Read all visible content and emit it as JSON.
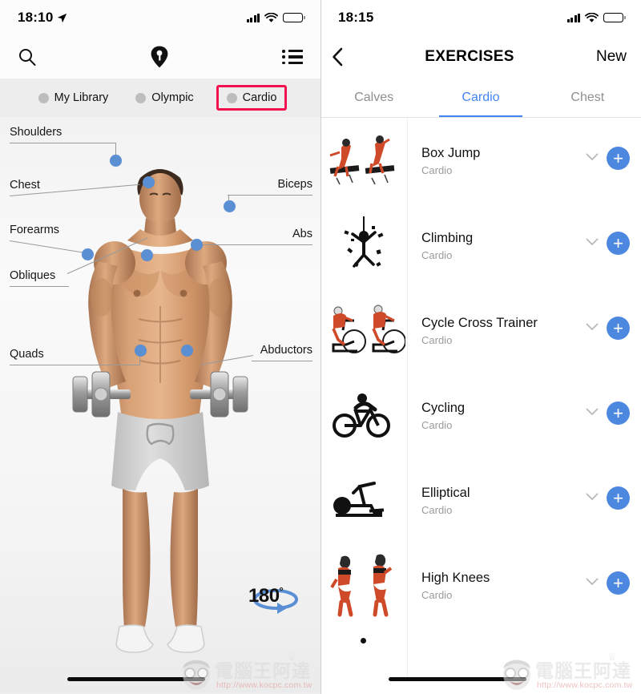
{
  "left_phone": {
    "status": {
      "time": "18:10",
      "location_icon": "location-arrow-icon",
      "signal_icon": "cellular-bars-icon",
      "wifi_icon": "wifi-icon",
      "battery_icon": "battery-icon"
    },
    "navbar": {
      "search_icon": "search-icon",
      "logo_icon": "pin-logo-icon",
      "menu_icon": "list-menu-icon"
    },
    "segments": [
      {
        "label": "My Library",
        "selected": false,
        "highlighted": false
      },
      {
        "label": "Olympic",
        "selected": false,
        "highlighted": false
      },
      {
        "label": "Cardio",
        "selected": true,
        "highlighted": true
      }
    ],
    "highlight_color": "#f3104e",
    "muscle_labels": [
      {
        "label": "Shoulders"
      },
      {
        "label": "Chest"
      },
      {
        "label": "Forearms"
      },
      {
        "label": "Obliques"
      },
      {
        "label": "Quads"
      },
      {
        "label": "Biceps"
      },
      {
        "label": "Abs"
      },
      {
        "label": "Abductors"
      }
    ],
    "rotate": {
      "value": "180",
      "degree": "°",
      "icon": "rotate-arrow-icon"
    },
    "dot_color": "#5b8fd4",
    "watermark": {
      "text": "電腦王阿達",
      "url": "http://www.kocpc.com.tw"
    }
  },
  "right_phone": {
    "status": {
      "time": "18:15",
      "signal_icon": "cellular-bars-icon",
      "wifi_icon": "wifi-icon",
      "battery_icon": "battery-icon"
    },
    "navbar": {
      "back_icon": "chevron-left-icon",
      "title": "EXERCISES",
      "action": "New"
    },
    "tabs": [
      {
        "label": "Calves",
        "active": false
      },
      {
        "label": "Cardio",
        "active": true
      },
      {
        "label": "Chest",
        "active": false
      }
    ],
    "accent_color": "#4285f4",
    "add_button_color": "#4d88e0",
    "exercises": [
      {
        "name": "Box Jump",
        "category": "Cardio",
        "thumb": "box-jump-illustration",
        "expand_icon": "chevron-down-icon",
        "add_icon": "plus-icon"
      },
      {
        "name": "Climbing",
        "category": "Cardio",
        "thumb": "climbing-illustration",
        "expand_icon": "chevron-down-icon",
        "add_icon": "plus-icon"
      },
      {
        "name": "Cycle Cross Trainer",
        "category": "Cardio",
        "thumb": "cycle-cross-trainer-illustration",
        "expand_icon": "chevron-down-icon",
        "add_icon": "plus-icon"
      },
      {
        "name": "Cycling",
        "category": "Cardio",
        "thumb": "cycling-illustration",
        "expand_icon": "chevron-down-icon",
        "add_icon": "plus-icon"
      },
      {
        "name": "Elliptical",
        "category": "Cardio",
        "thumb": "elliptical-illustration",
        "expand_icon": "chevron-down-icon",
        "add_icon": "plus-icon"
      },
      {
        "name": "High Knees",
        "category": "Cardio",
        "thumb": "high-knees-illustration",
        "expand_icon": "chevron-down-icon",
        "add_icon": "plus-icon"
      }
    ],
    "watermark": {
      "text": "電腦王阿達",
      "url": "http://www.kocpc.com.tw"
    }
  }
}
